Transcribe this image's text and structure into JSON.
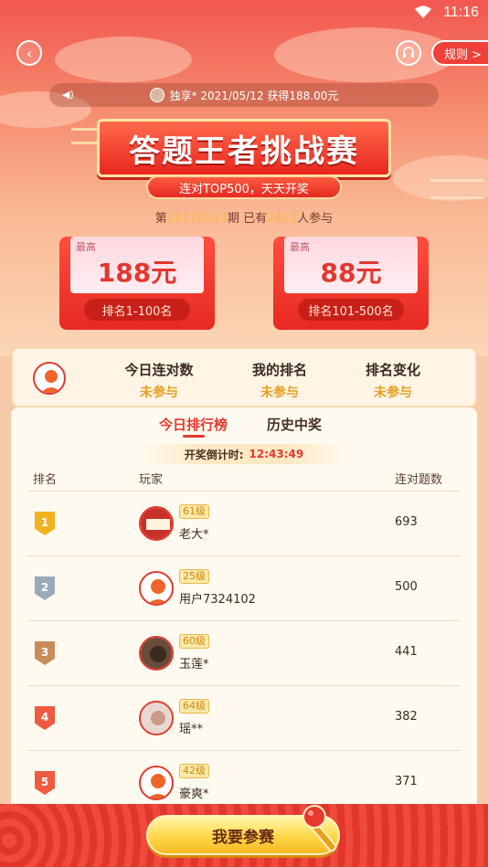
{
  "status": {
    "time": "11:16"
  },
  "header": {
    "rules_label": "规则 >"
  },
  "ticker": {
    "text": "独享* 2021/05/12 获得188.00元"
  },
  "banner": {
    "title": "答题王者挑战赛",
    "subtitle": "连对TOP500，天天开奖"
  },
  "period": {
    "prefix": "第",
    "issue": "20210514",
    "mid": "期 已有",
    "count": "2452",
    "suffix": "人参与"
  },
  "prizes": [
    {
      "tag": "最高",
      "amount": "188元",
      "range": "排名1-100名"
    },
    {
      "tag": "最高",
      "amount": "88元",
      "range": "排名101-500名"
    }
  ],
  "my_stats": [
    {
      "label": "今日连对数",
      "value": "未参与"
    },
    {
      "label": "我的排名",
      "value": "未参与"
    },
    {
      "label": "排名变化",
      "value": "未参与"
    }
  ],
  "tabs": [
    {
      "label": "今日排行榜"
    },
    {
      "label": "历史中奖"
    }
  ],
  "countdown": {
    "label": "开奖倒计时:",
    "time": "12:43:49"
  },
  "columns": {
    "rank": "排名",
    "player": "玩家",
    "score": "连对题数"
  },
  "rows": [
    {
      "rank": "1",
      "level": "61级",
      "name": "老大*",
      "score": "693",
      "badge_color": "#f2b21e"
    },
    {
      "rank": "2",
      "level": "25级",
      "name": "用户7324102",
      "score": "500",
      "badge_color": "#9aaab8"
    },
    {
      "rank": "3",
      "level": "60级",
      "name": "玉莲*",
      "score": "441",
      "badge_color": "#c88c58"
    },
    {
      "rank": "4",
      "level": "64级",
      "name": "瑶**",
      "score": "382",
      "badge_color": "#ef5a42"
    },
    {
      "rank": "5",
      "level": "42级",
      "name": "豪爽*",
      "score": "371",
      "badge_color": "#ef5a42"
    }
  ],
  "cta": {
    "label": "我要参赛"
  },
  "colors": {
    "accent": "#e23a2e",
    "gold": "#e6a020",
    "banner_red": "#e9261f"
  }
}
